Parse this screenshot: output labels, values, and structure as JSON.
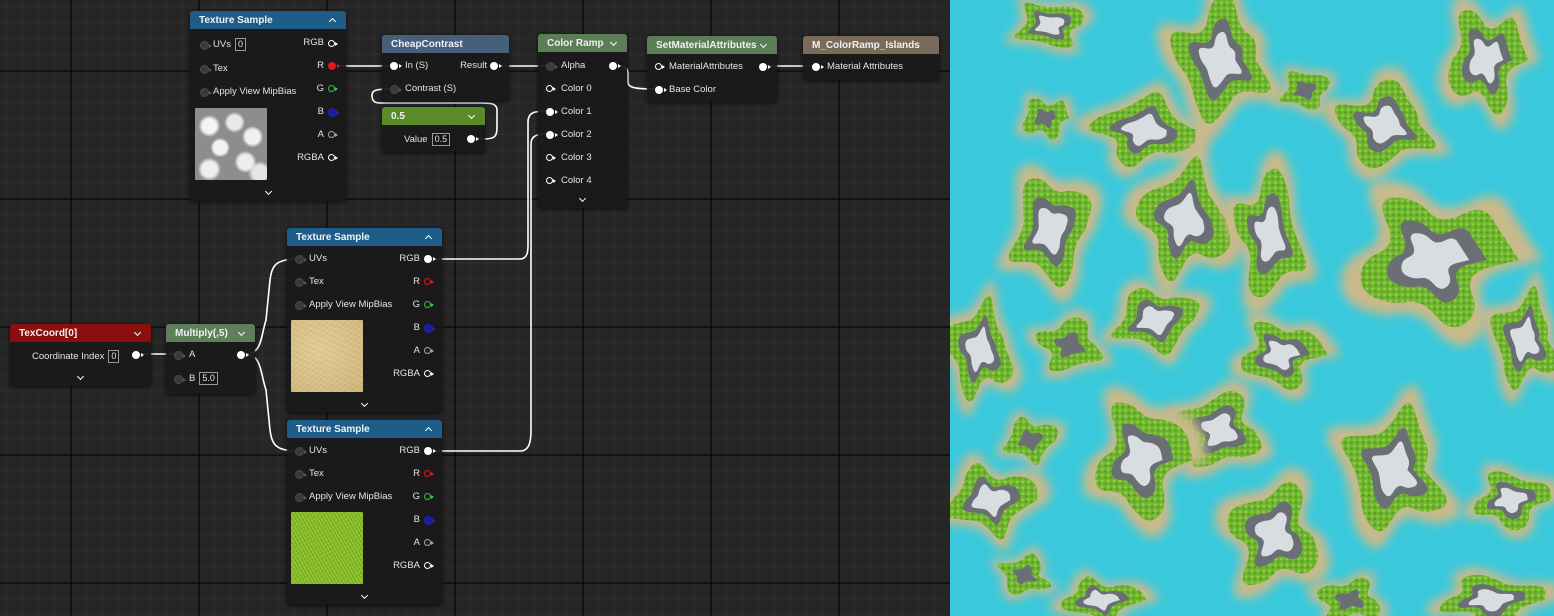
{
  "nodes": {
    "texsample_top": {
      "title": "Texture Sample",
      "uvs_label": "UVs",
      "uvs_value": "0",
      "tex_label": "Tex",
      "mip_label": "Apply View MipBias",
      "outputs": [
        "RGB",
        "R",
        "G",
        "B",
        "A",
        "RGBA"
      ]
    },
    "cheap_contrast": {
      "title": "CheapContrast",
      "in_label": "In (S)",
      "result_label": "Result",
      "contrast_label": "Contrast (S)"
    },
    "const_value": {
      "title": "0.5",
      "value_label": "Value",
      "value": "0.5"
    },
    "color_ramp": {
      "title": "Color Ramp",
      "inputs": [
        "Alpha",
        "Color 0",
        "Color 1",
        "Color 2",
        "Color 3",
        "Color 4"
      ]
    },
    "set_material_attributes": {
      "title": "SetMaterialAttributes",
      "material_attributes_label": "MaterialAttributes",
      "base_color_label": "Base Color"
    },
    "output_node": {
      "title": "M_ColorRamp_Islands",
      "material_attributes_label": "Material Attributes"
    },
    "texsample_sand": {
      "title": "Texture Sample",
      "uvs_label": "UVs",
      "tex_label": "Tex",
      "mip_label": "Apply View MipBias",
      "outputs": [
        "RGB",
        "R",
        "G",
        "B",
        "A",
        "RGBA"
      ]
    },
    "texsample_grass": {
      "title": "Texture Sample",
      "uvs_label": "UVs",
      "tex_label": "Tex",
      "mip_label": "Apply View MipBias",
      "outputs": [
        "RGB",
        "R",
        "G",
        "B",
        "A",
        "RGBA"
      ]
    },
    "texcoord": {
      "title": "TexCoord[0]",
      "coord_label": "Coordinate Index",
      "coord_value": "0"
    },
    "multiply": {
      "title": "Multiply(,5)",
      "a_label": "A",
      "b_label": "B",
      "b_value": "5.0"
    }
  },
  "colors": {
    "texture_header": "#1e5d8a",
    "function_header": "#46607c",
    "constant_header": "#5a8a2a",
    "ramp_header": "#5b7e56",
    "attributes_header": "#5b7e56",
    "output_header": "#7a6a5a",
    "texcoord_header": "#8b0f0f",
    "multiply_header": "#5f7f5a",
    "water": "#3ac9dc",
    "sand": "#c8b98a",
    "grass": "#6fb52f",
    "rock": "#6a6f76",
    "snow": "#d8dde2"
  },
  "icons": [
    "chevron-up-icon",
    "chevron-down-icon",
    "pin-icon"
  ]
}
